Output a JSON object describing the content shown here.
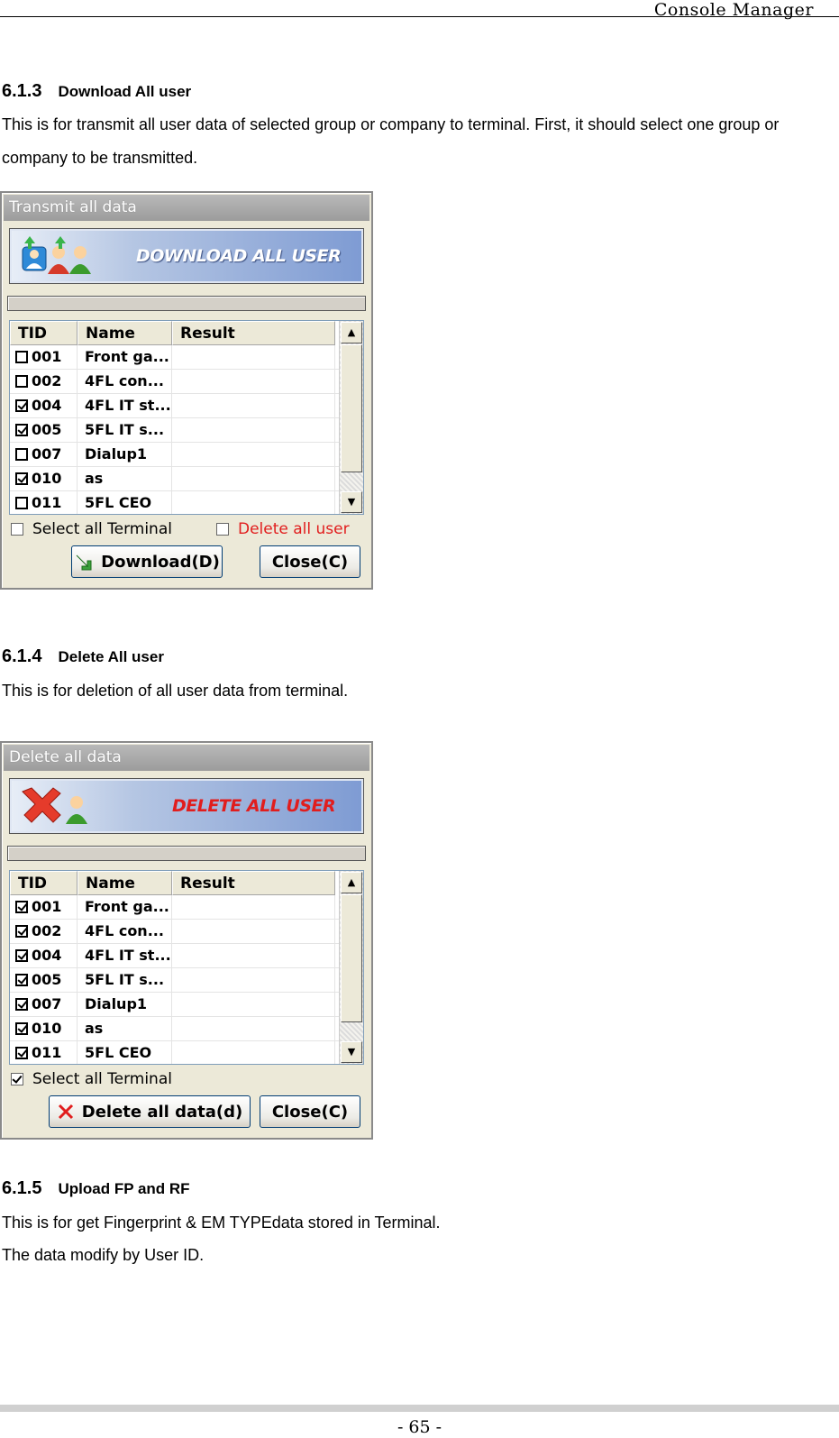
{
  "header": {
    "title": "Console Manager"
  },
  "sections": [
    {
      "number": "6.1.3",
      "name": "Download All user",
      "paragraphs": [
        "This is for transmit all user data of selected group or company to terminal. First, it should select one group or company to be transmitted."
      ],
      "dialog": {
        "title": "Transmit all data",
        "banner": "DOWNLOAD ALL USER",
        "banner_icon": "users-download-icon",
        "columns": [
          "TID",
          "Name",
          "Result"
        ],
        "rows": [
          {
            "checked": false,
            "tid": "001",
            "name": "Front ga...",
            "result": ""
          },
          {
            "checked": false,
            "tid": "002",
            "name": "4FL con...",
            "result": ""
          },
          {
            "checked": true,
            "tid": "004",
            "name": "4FL IT st...",
            "result": ""
          },
          {
            "checked": true,
            "tid": "005",
            "name": "5FL IT s...",
            "result": ""
          },
          {
            "checked": false,
            "tid": "007",
            "name": "Dialup1",
            "result": ""
          },
          {
            "checked": true,
            "tid": "010",
            "name": "as",
            "result": ""
          },
          {
            "checked": false,
            "tid": "011",
            "name": "5FL CEO",
            "result": ""
          }
        ],
        "select_all_label": "Select all Terminal",
        "select_all_checked": false,
        "delete_all_label": "Delete all user",
        "delete_all_checked": false,
        "primary_button": "Download(D)",
        "close_button": "Close(C)"
      }
    },
    {
      "number": "6.1.4",
      "name": "Delete All user",
      "paragraphs": [
        "This is for deletion of all user data from terminal."
      ],
      "dialog": {
        "title": "Delete all data",
        "banner": "DELETE ALL USER",
        "banner_icon": "user-delete-icon",
        "columns": [
          "TID",
          "Name",
          "Result"
        ],
        "rows": [
          {
            "checked": true,
            "tid": "001",
            "name": "Front ga...",
            "result": ""
          },
          {
            "checked": true,
            "tid": "002",
            "name": "4FL con...",
            "result": ""
          },
          {
            "checked": true,
            "tid": "004",
            "name": "4FL IT st...",
            "result": ""
          },
          {
            "checked": true,
            "tid": "005",
            "name": "5FL IT s...",
            "result": ""
          },
          {
            "checked": true,
            "tid": "007",
            "name": "Dialup1",
            "result": ""
          },
          {
            "checked": true,
            "tid": "010",
            "name": "as",
            "result": ""
          },
          {
            "checked": true,
            "tid": "011",
            "name": "5FL CEO",
            "result": ""
          }
        ],
        "select_all_label": "Select all Terminal",
        "select_all_checked": true,
        "primary_button": "Delete all data(d)",
        "close_button": "Close(C)"
      }
    },
    {
      "number": "6.1.5",
      "name": "Upload FP and RF",
      "paragraphs": [
        "This is for get Fingerprint & EM TYPEdata stored in Terminal.",
        "The data modify by User ID."
      ]
    }
  ],
  "footer": {
    "page": "- 65 -"
  },
  "colors": {
    "accent_red": "#e11d1d",
    "banner_blue": "#7e9bd3"
  }
}
